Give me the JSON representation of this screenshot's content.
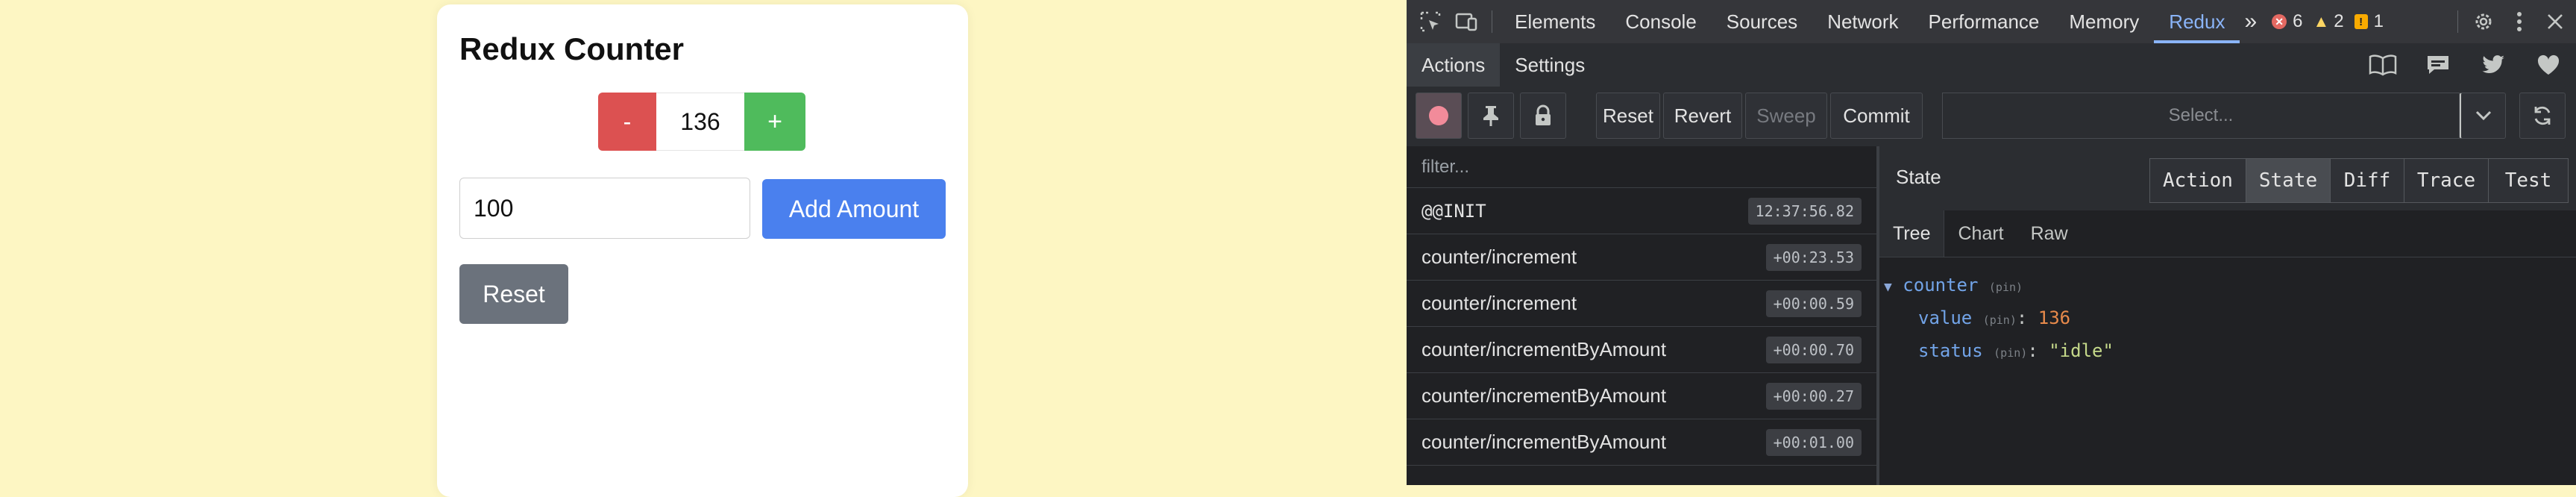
{
  "app": {
    "title": "Redux Counter",
    "decrement_label": "-",
    "count": "136",
    "increment_label": "+",
    "amount_value": "100",
    "add_amount_label": "Add Amount",
    "reset_label": "Reset"
  },
  "devtools": {
    "tabs": [
      "Elements",
      "Console",
      "Sources",
      "Network",
      "Performance",
      "Memory",
      "Redux"
    ],
    "active_tab": "Redux",
    "more_label": "»",
    "errors": "6",
    "warnings": "2",
    "issues": "1",
    "redux": {
      "subtabs": [
        "Actions",
        "Settings"
      ],
      "toolbar": {
        "reset": "Reset",
        "revert": "Revert",
        "sweep": "Sweep",
        "commit": "Commit",
        "select_placeholder": "Select..."
      },
      "filter_placeholder": "filter...",
      "actions": [
        {
          "name": "@@INIT",
          "time": "12:37:56.82"
        },
        {
          "name": "counter/increment",
          "time": "+00:23.53"
        },
        {
          "name": "counter/increment",
          "time": "+00:00.59"
        },
        {
          "name": "counter/incrementByAmount",
          "time": "+00:00.70"
        },
        {
          "name": "counter/incrementByAmount",
          "time": "+00:00.27"
        },
        {
          "name": "counter/incrementByAmount",
          "time": "+00:01.00"
        }
      ],
      "state_title": "State",
      "monitors": [
        "Action",
        "State",
        "Diff",
        "Trace",
        "Test"
      ],
      "active_monitor": "State",
      "state_tabs": [
        "Tree",
        "Chart",
        "Raw"
      ],
      "tree": {
        "root_key": "counter",
        "pin": "(pin)",
        "value_key": "value",
        "value": "136",
        "status_key": "status",
        "status": "\"idle\""
      }
    }
  },
  "colors": {
    "page_bg": "#fdf6c3",
    "decrement": "#dc5151",
    "increment": "#4fbb5c",
    "primary": "#4a80ee",
    "secondary": "#6b727c",
    "devtools_accent": "#8ab4f8"
  }
}
